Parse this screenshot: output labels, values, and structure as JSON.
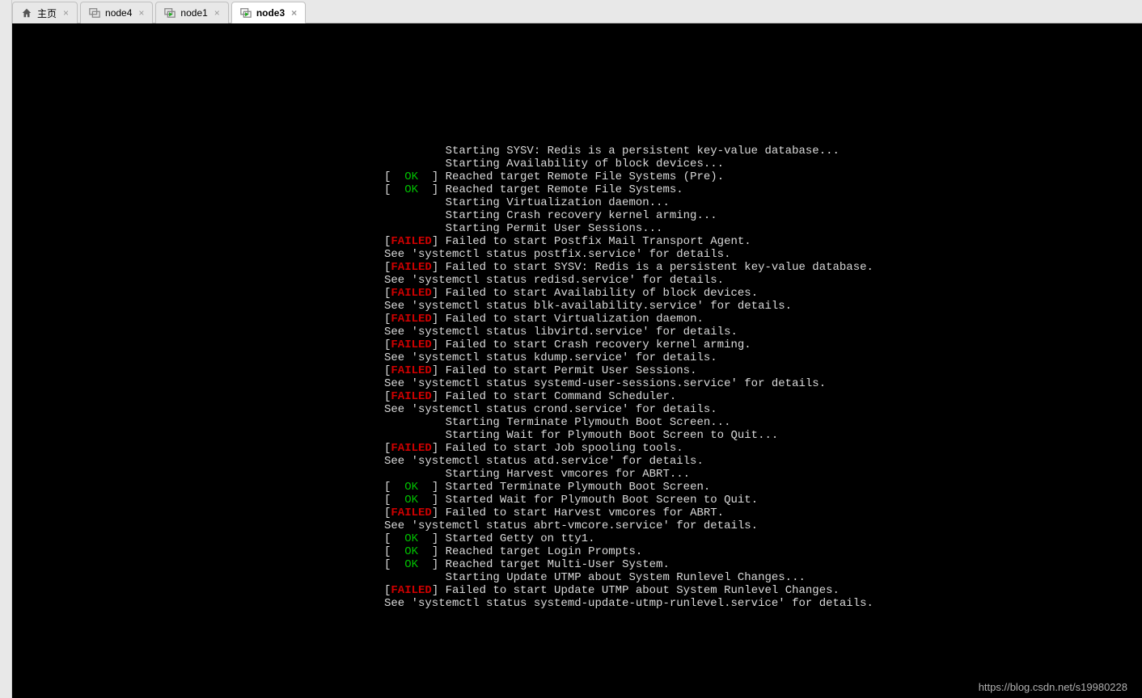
{
  "tabs": [
    {
      "label": "主页",
      "icon": "home"
    },
    {
      "label": "node4",
      "icon": "vm-gray"
    },
    {
      "label": "node1",
      "icon": "vm-green"
    },
    {
      "label": "node3",
      "icon": "vm-green"
    }
  ],
  "terminal": {
    "lines": [
      {
        "type": "indent",
        "text": "Starting SYSV: Redis is a persistent key-value database..."
      },
      {
        "type": "indent",
        "text": "Starting Availability of block devices..."
      },
      {
        "type": "ok",
        "text": "Reached target Remote File Systems (Pre)."
      },
      {
        "type": "ok",
        "text": "Reached target Remote File Systems."
      },
      {
        "type": "indent",
        "text": "Starting Virtualization daemon..."
      },
      {
        "type": "indent",
        "text": "Starting Crash recovery kernel arming..."
      },
      {
        "type": "indent",
        "text": "Starting Permit User Sessions..."
      },
      {
        "type": "failed",
        "text": "Failed to start Postfix Mail Transport Agent."
      },
      {
        "type": "plain",
        "text": "See 'systemctl status postfix.service' for details."
      },
      {
        "type": "failed",
        "text": "Failed to start SYSV: Redis is a persistent key-value database."
      },
      {
        "type": "plain",
        "text": "See 'systemctl status redisd.service' for details."
      },
      {
        "type": "failed",
        "text": "Failed to start Availability of block devices."
      },
      {
        "type": "plain",
        "text": "See 'systemctl status blk-availability.service' for details."
      },
      {
        "type": "failed",
        "text": "Failed to start Virtualization daemon."
      },
      {
        "type": "plain",
        "text": "See 'systemctl status libvirtd.service' for details."
      },
      {
        "type": "failed",
        "text": "Failed to start Crash recovery kernel arming."
      },
      {
        "type": "plain",
        "text": "See 'systemctl status kdump.service' for details."
      },
      {
        "type": "failed",
        "text": "Failed to start Permit User Sessions."
      },
      {
        "type": "plain",
        "text": "See 'systemctl status systemd-user-sessions.service' for details."
      },
      {
        "type": "failed",
        "text": "Failed to start Command Scheduler."
      },
      {
        "type": "plain",
        "text": "See 'systemctl status crond.service' for details."
      },
      {
        "type": "indent",
        "text": "Starting Terminate Plymouth Boot Screen..."
      },
      {
        "type": "indent",
        "text": "Starting Wait for Plymouth Boot Screen to Quit..."
      },
      {
        "type": "failed",
        "text": "Failed to start Job spooling tools."
      },
      {
        "type": "plain",
        "text": "See 'systemctl status atd.service' for details."
      },
      {
        "type": "indent",
        "text": "Starting Harvest vmcores for ABRT..."
      },
      {
        "type": "ok",
        "text": "Started Terminate Plymouth Boot Screen."
      },
      {
        "type": "ok",
        "text": "Started Wait for Plymouth Boot Screen to Quit."
      },
      {
        "type": "failed",
        "text": "Failed to start Harvest vmcores for ABRT."
      },
      {
        "type": "plain",
        "text": "See 'systemctl status abrt-vmcore.service' for details."
      },
      {
        "type": "ok",
        "text": "Started Getty on tty1."
      },
      {
        "type": "ok",
        "text": "Reached target Login Prompts."
      },
      {
        "type": "ok",
        "text": "Reached target Multi-User System."
      },
      {
        "type": "indent",
        "text": "Starting Update UTMP about System Runlevel Changes..."
      },
      {
        "type": "failed",
        "text": "Failed to start Update UTMP about System Runlevel Changes."
      },
      {
        "type": "plain",
        "text": "See 'systemctl status systemd-update-utmp-runlevel.service' for details."
      }
    ]
  },
  "status_labels": {
    "ok": "OK",
    "failed": "FAILED"
  },
  "watermark": "https://blog.csdn.net/s19980228"
}
